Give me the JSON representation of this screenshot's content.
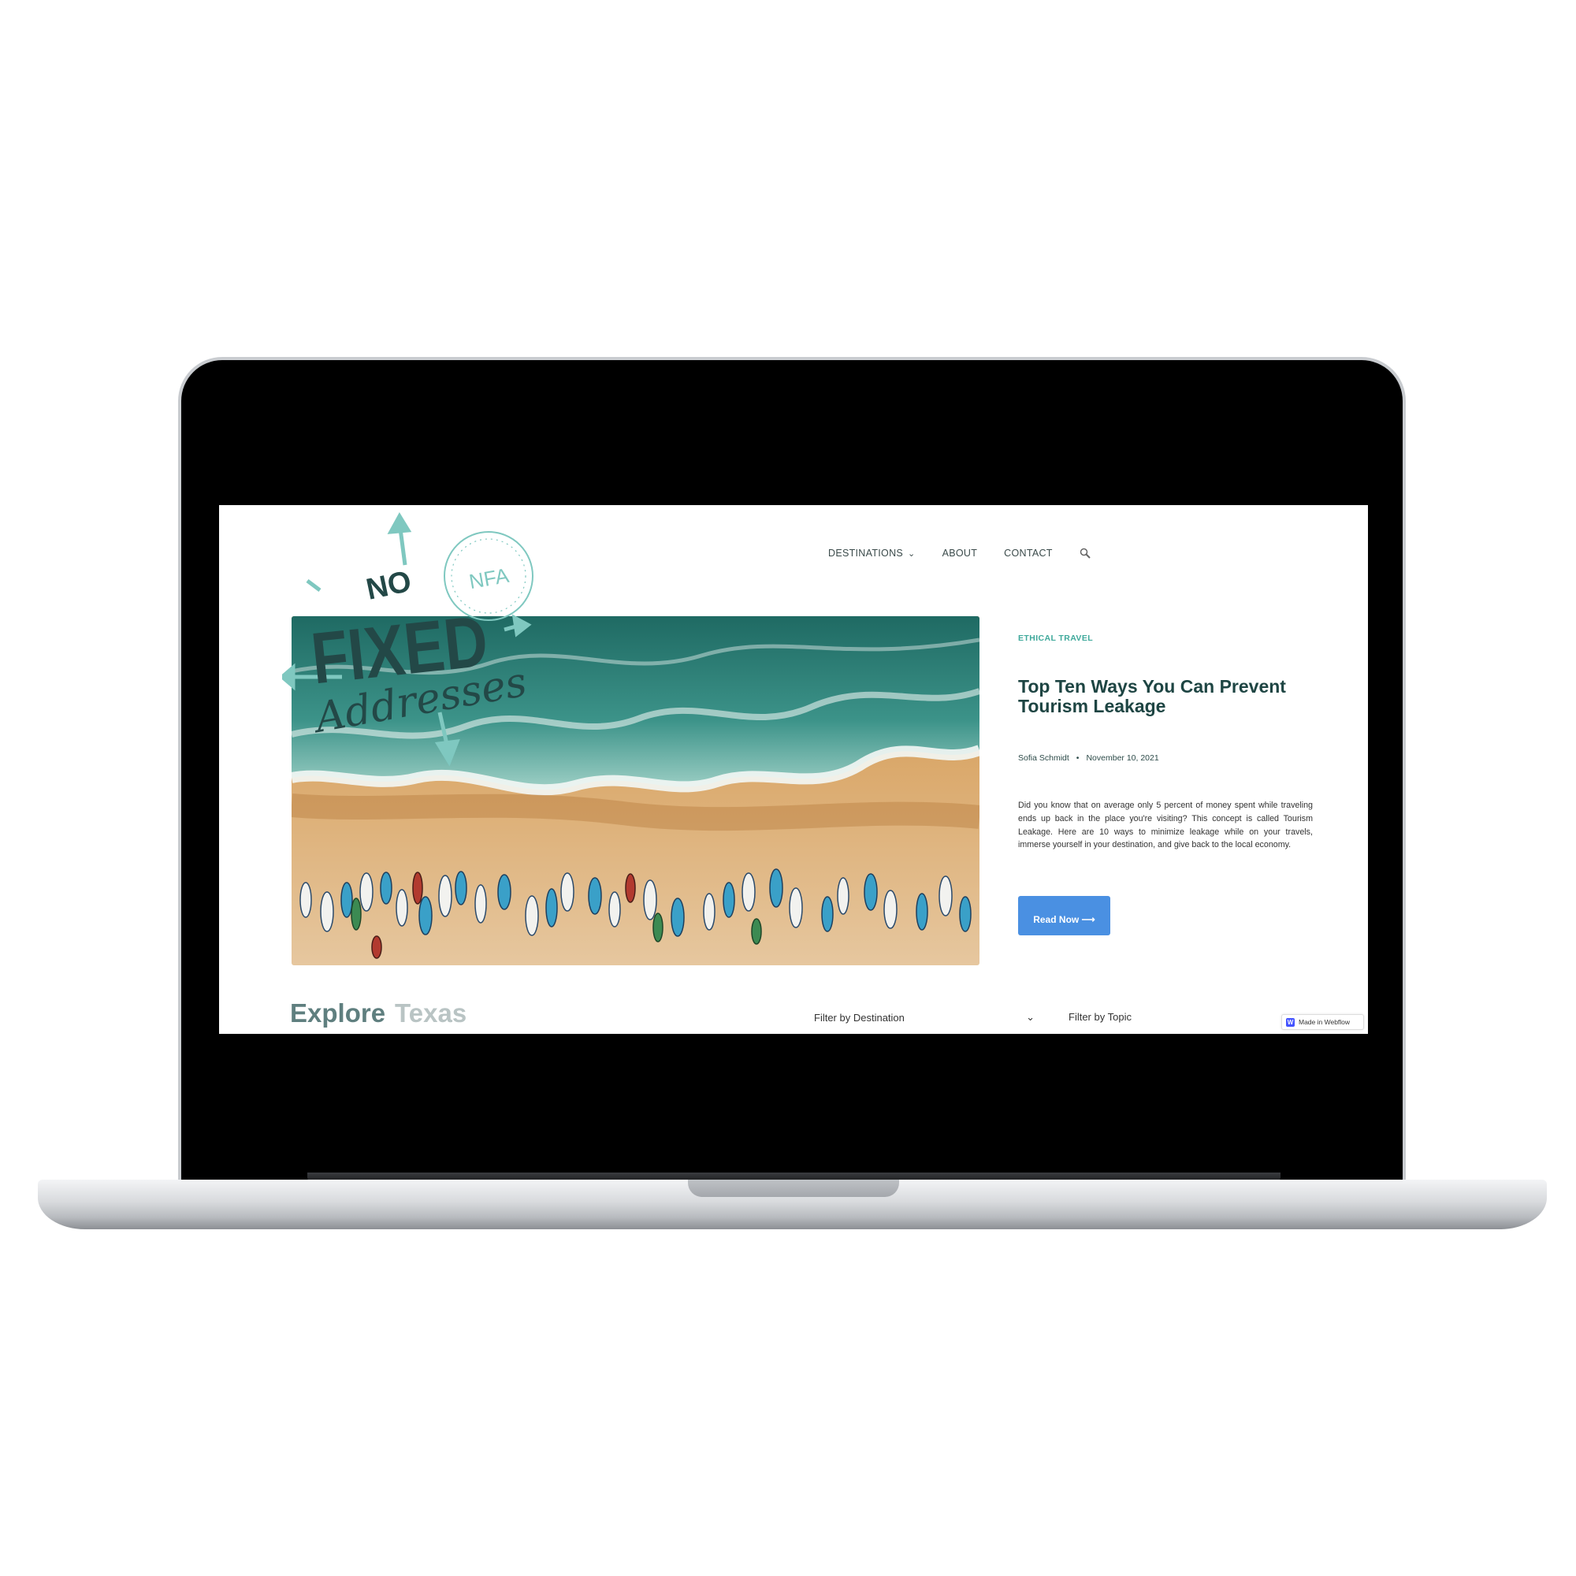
{
  "nav": {
    "destinations": "DESTINATIONS",
    "about": "ABOUT",
    "contact": "CONTACT"
  },
  "logo": {
    "line1": "NO",
    "line2": "FIXED",
    "line3": "Addresses",
    "stamp": "NFA"
  },
  "featured": {
    "category": "ETHICAL TRAVEL",
    "title": "Top Ten Ways You Can Prevent Tourism Leakage",
    "author": "Sofia Schmidt",
    "separator": "•",
    "date": "November 10, 2021",
    "excerpt": "Did you know that on average only 5 percent of money spent while traveling ends up back in the place you're visiting? This concept is called Tourism Leakage. Here are 10 ways to minimize leakage while on your travels, immerse yourself in your destination, and give back to the local economy.",
    "button": "Read Now ⟶"
  },
  "explore": {
    "word1": "Explore",
    "word2": "Texas"
  },
  "filters": {
    "destination": "Filter by Destination",
    "topic": "Filter by Topic"
  },
  "badge": {
    "text": "Made in Webflow",
    "logo_letter": "W"
  },
  "colors": {
    "brand_dark": "#1e4543",
    "accent_teal": "#3fa99b",
    "button_blue": "#4a90e2"
  }
}
